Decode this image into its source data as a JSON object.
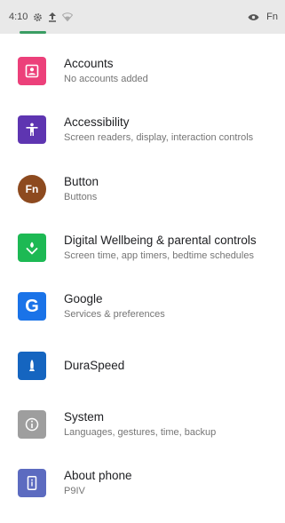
{
  "status_bar": {
    "time": "4:10",
    "right_text": "Fn",
    "icons": [
      "gear-icon",
      "upload-icon",
      "wifi-icon",
      "eye-icon"
    ]
  },
  "settings": {
    "items": [
      {
        "title": "Accounts",
        "subtitle": "No accounts added",
        "icon": "accounts-icon",
        "color": "#ec407a"
      },
      {
        "title": "Accessibility",
        "subtitle": "Screen readers, display, interaction controls",
        "icon": "accessibility-icon",
        "color": "#5e35b1"
      },
      {
        "title": "Button",
        "subtitle": "Buttons",
        "icon": "fn-button-icon",
        "icon_text": "Fn",
        "color": "#8d4a1f"
      },
      {
        "title": "Digital Wellbeing & parental controls",
        "subtitle": "Screen time, app timers, bedtime schedules",
        "icon": "wellbeing-icon",
        "color": "#1db954"
      },
      {
        "title": "Google",
        "subtitle": "Services & preferences",
        "icon": "google-icon",
        "icon_text": "G",
        "color": "#1a73e8"
      },
      {
        "title": "DuraSpeed",
        "subtitle": "",
        "icon": "rocket-icon",
        "color": "#1565c0"
      },
      {
        "title": "System",
        "subtitle": "Languages, gestures, time, backup",
        "icon": "info-icon",
        "color": "#9e9e9e"
      },
      {
        "title": "About phone",
        "subtitle": "P9IV",
        "icon": "phone-icon",
        "color": "#5c6bc0"
      }
    ]
  }
}
